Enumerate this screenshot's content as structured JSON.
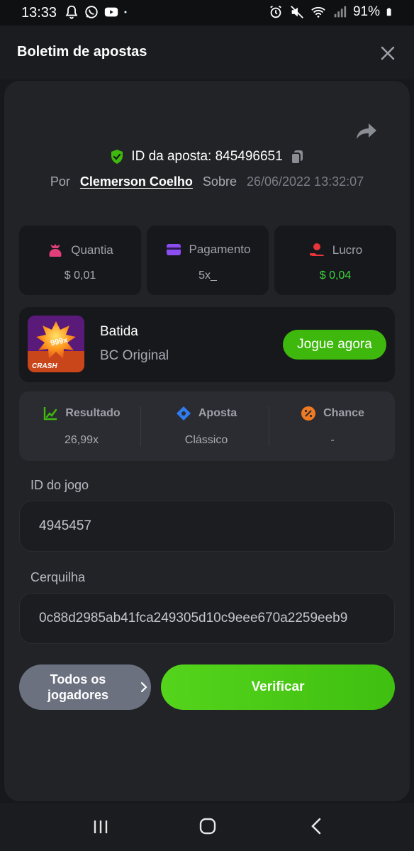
{
  "status_bar": {
    "time": "13:33",
    "battery": "91%"
  },
  "header": {
    "title": "Boletim de apostas"
  },
  "bet": {
    "id_label": "ID da aposta: 845496651",
    "by_label": "Por",
    "player": "Clemerson Coelho",
    "about_label": "Sobre",
    "datetime": "26/06/2022 13:32:07"
  },
  "stats": [
    {
      "label": "Quantia",
      "value": "$ 0,01",
      "icon": "money-bag-icon",
      "color": "#e23f7a"
    },
    {
      "label": "Pagamento",
      "value": "5x_",
      "icon": "card-icon",
      "color": "#8b4df0"
    },
    {
      "label": "Lucro",
      "value": "$ 0,04",
      "icon": "hand-coin-icon",
      "color": "#e8343a"
    }
  ],
  "game": {
    "name": "Batida",
    "provider": "BC Original",
    "play_label": "Jogue agora",
    "thumb_text": "999x",
    "thumb_caption": "CRASH"
  },
  "result": [
    {
      "label": "Resultado",
      "value": "26,99x",
      "icon": "chart-icon",
      "color": "#3fb80e"
    },
    {
      "label": "Aposta",
      "value": "Clássico",
      "icon": "diamond-icon",
      "color": "#2f7bf0"
    },
    {
      "label": "Chance",
      "value": "-",
      "icon": "percent-icon",
      "color": "#ef7a22"
    }
  ],
  "game_id": {
    "label": "ID do jogo",
    "value": "4945457"
  },
  "hash": {
    "label": "Cerquilha",
    "value": "0c88d2985ab41fca249305d10c9eee670a2259eeb9"
  },
  "actions": {
    "all_players": "Todos os jogadores",
    "verify": "Verificar"
  },
  "colors": {
    "accent_green": "#3fb80e",
    "profit_green": "#3ed43e",
    "card_bg": "#222327"
  }
}
